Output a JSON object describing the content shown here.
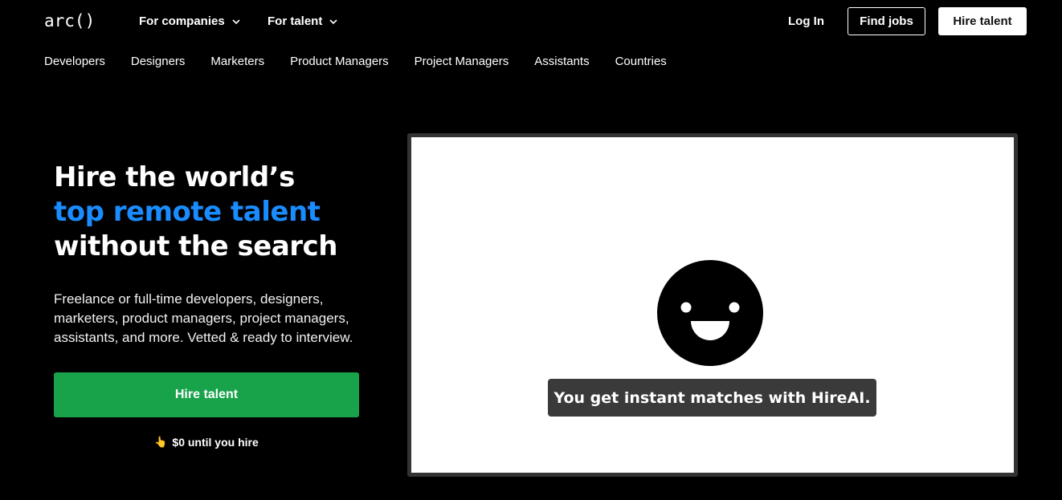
{
  "header": {
    "logo": "arc()",
    "nav_companies": "For companies",
    "nav_talent": "For talent",
    "login": "Log In",
    "find_jobs": "Find jobs",
    "hire_talent": "Hire talent"
  },
  "subnav": [
    "Developers",
    "Designers",
    "Marketers",
    "Product Managers",
    "Project Managers",
    "Assistants",
    "Countries"
  ],
  "hero": {
    "title_line1": "Hire the world’s",
    "title_line2": "top remote talent",
    "title_line3": "without the search",
    "description": "Freelance or full-time developers, designers, marketers, product managers, project managers, assistants, and more. Vetted & ready to interview.",
    "cta": "Hire talent",
    "price_icon": "👆",
    "price_note": "$0 until you hire"
  },
  "video": {
    "caption": "You get instant matches with HireAI.",
    "icon": "smiley-face-icon"
  },
  "colors": {
    "accent_blue": "#1a8cff",
    "cta_green": "#18a34a",
    "background": "#000000"
  }
}
